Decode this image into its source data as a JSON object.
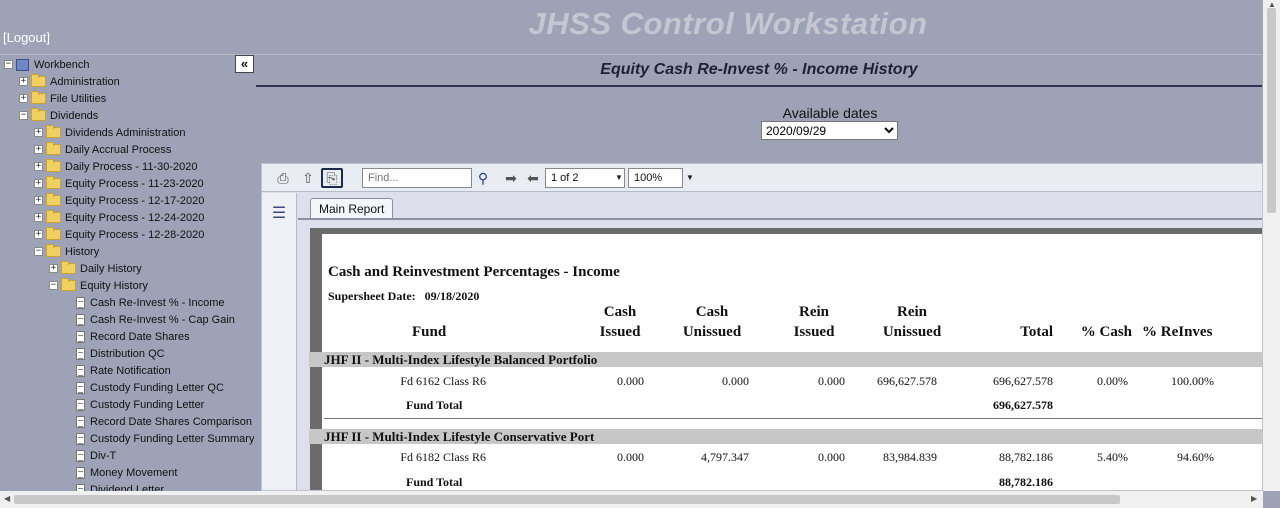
{
  "app": {
    "title": "JHSS Control Workstation",
    "logout_label": "[Logout]"
  },
  "sidebar": {
    "collapse_label": "«",
    "tree": [
      {
        "label": "Workbench",
        "type": "root",
        "expander": "−"
      },
      {
        "label": "Administration",
        "type": "folder",
        "expander": "+"
      },
      {
        "label": "File Utilities",
        "type": "folder",
        "expander": "+"
      },
      {
        "label": "Dividends",
        "type": "folder",
        "expander": "−"
      },
      {
        "label": "Dividends Administration",
        "type": "folder",
        "expander": "+"
      },
      {
        "label": "Daily Accrual Process",
        "type": "folder",
        "expander": "+"
      },
      {
        "label": "Daily Process - 11-30-2020",
        "type": "folder",
        "expander": "+"
      },
      {
        "label": "Equity Process - 11-23-2020",
        "type": "folder",
        "expander": "+"
      },
      {
        "label": "Equity Process - 12-17-2020",
        "type": "folder",
        "expander": "+"
      },
      {
        "label": "Equity Process - 12-24-2020",
        "type": "folder",
        "expander": "+"
      },
      {
        "label": "Equity Process - 12-28-2020",
        "type": "folder",
        "expander": "+"
      },
      {
        "label": "History",
        "type": "folder",
        "expander": "−"
      },
      {
        "label": "Daily History",
        "type": "folder",
        "expander": "+"
      },
      {
        "label": "Equity History",
        "type": "folder",
        "expander": "−"
      },
      {
        "label": "Cash Re-Invest % - Income",
        "type": "doc"
      },
      {
        "label": "Cash Re-Invest % - Cap Gain",
        "type": "doc"
      },
      {
        "label": "Record Date Shares",
        "type": "doc"
      },
      {
        "label": "Distribution QC",
        "type": "doc"
      },
      {
        "label": "Rate Notification",
        "type": "doc"
      },
      {
        "label": "Custody Funding Letter QC",
        "type": "doc"
      },
      {
        "label": "Custody Funding Letter",
        "type": "doc"
      },
      {
        "label": "Record Date Shares Comparison",
        "type": "doc"
      },
      {
        "label": "Custody Funding Letter Summary",
        "type": "doc"
      },
      {
        "label": "Div-T",
        "type": "doc"
      },
      {
        "label": "Money Movement",
        "type": "doc"
      },
      {
        "label": "Dividend Letter",
        "type": "doc"
      }
    ]
  },
  "main": {
    "report_title": "Equity Cash Re-Invest % - Income History",
    "dates_label": "Available dates",
    "dates_selected": "2020/09/29"
  },
  "viewer": {
    "find_placeholder": "Find...",
    "page_indicator": "1 of 2",
    "zoom": "100%",
    "tab_label": "Main Report"
  },
  "report": {
    "title": "Cash and Reinvestment Percentages - Income",
    "supersheet_label": "Supersheet Date:",
    "supersheet_date": "09/18/2020",
    "columns": {
      "fund": "Fund",
      "cash_issued": [
        "Cash",
        "Issued"
      ],
      "cash_unissued": [
        "Cash",
        "Unissued"
      ],
      "rein_issued": [
        "Rein",
        "Issued"
      ],
      "rein_unissued": [
        "Rein",
        "Unissued"
      ],
      "total": "Total",
      "pct_cash": "% Cash",
      "pct_reinvest": "% ReInves"
    },
    "groups": [
      {
        "name": "JHF II - Multi-Index Lifestyle Balanced Portfolio",
        "row": {
          "fund": "Fd 6162 Class R6",
          "cash_issued": "0.000",
          "cash_unissued": "0.000",
          "rein_issued": "0.000",
          "rein_unissued": "696,627.578",
          "total": "696,627.578",
          "pct_cash": "0.00%",
          "pct_reinvest": "100.00%"
        },
        "fund_total_label": "Fund Total",
        "fund_total": "696,627.578"
      },
      {
        "name": "JHF II - Multi-Index Lifestyle Conservative Port",
        "row": {
          "fund": "Fd 6182 Class R6",
          "cash_issued": "0.000",
          "cash_unissued": "4,797.347",
          "rein_issued": "0.000",
          "rein_unissued": "83,984.839",
          "total": "88,782.186",
          "pct_cash": "5.40%",
          "pct_reinvest": "94.60%"
        },
        "fund_total_label": "Fund Total",
        "fund_total": "88,782.186"
      }
    ]
  }
}
